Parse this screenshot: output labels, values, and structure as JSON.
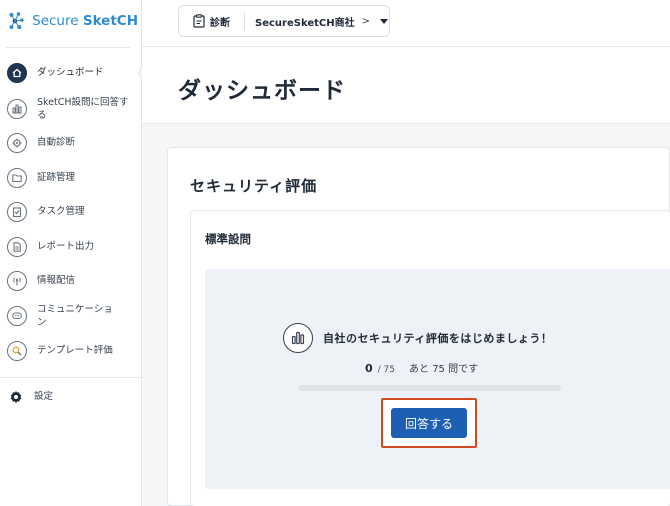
{
  "app": {
    "logo_primary": "Secure ",
    "logo_secondary": "SketCH",
    "brand_color": "#2e8bd1"
  },
  "topbar": {
    "context_label": "診断",
    "company": "SecureSketCH商社",
    "chevron": ">",
    "icon": "clipboard-icon"
  },
  "sidebar": {
    "items": [
      {
        "label": "ダッシュボード",
        "icon": "home-icon",
        "active": true
      },
      {
        "label": "SketCH設問に回答する",
        "icon": "bar-chart-icon",
        "active": false
      },
      {
        "label": "自動診断",
        "icon": "gear-icon",
        "active": false
      },
      {
        "label": "証跡管理",
        "icon": "folder-icon",
        "active": false
      },
      {
        "label": "タスク管理",
        "icon": "task-icon",
        "active": false
      },
      {
        "label": "レポート出力",
        "icon": "document-icon",
        "active": false
      },
      {
        "label": "情報配信",
        "icon": "broadcast-icon",
        "active": false
      },
      {
        "label": "コミュニケーション",
        "icon": "chat-icon",
        "active": false
      },
      {
        "label": "テンプレート評価",
        "icon": "template-search-icon",
        "active": false
      }
    ],
    "settings": {
      "label": "設定",
      "icon": "gear-icon"
    }
  },
  "page": {
    "title": "ダッシュボード"
  },
  "security_card": {
    "title": "セキュリティ評価",
    "section_title": "標準設問",
    "message": "自社のセキュリティ評価をはじめましょう！",
    "answered": "0",
    "total": "/ 75",
    "remaining": "あと 75 問です",
    "progress_fraction": 0,
    "button_label": "回答する",
    "button_color": "#1d5fb5",
    "highlight_color": "#d04a1f"
  }
}
